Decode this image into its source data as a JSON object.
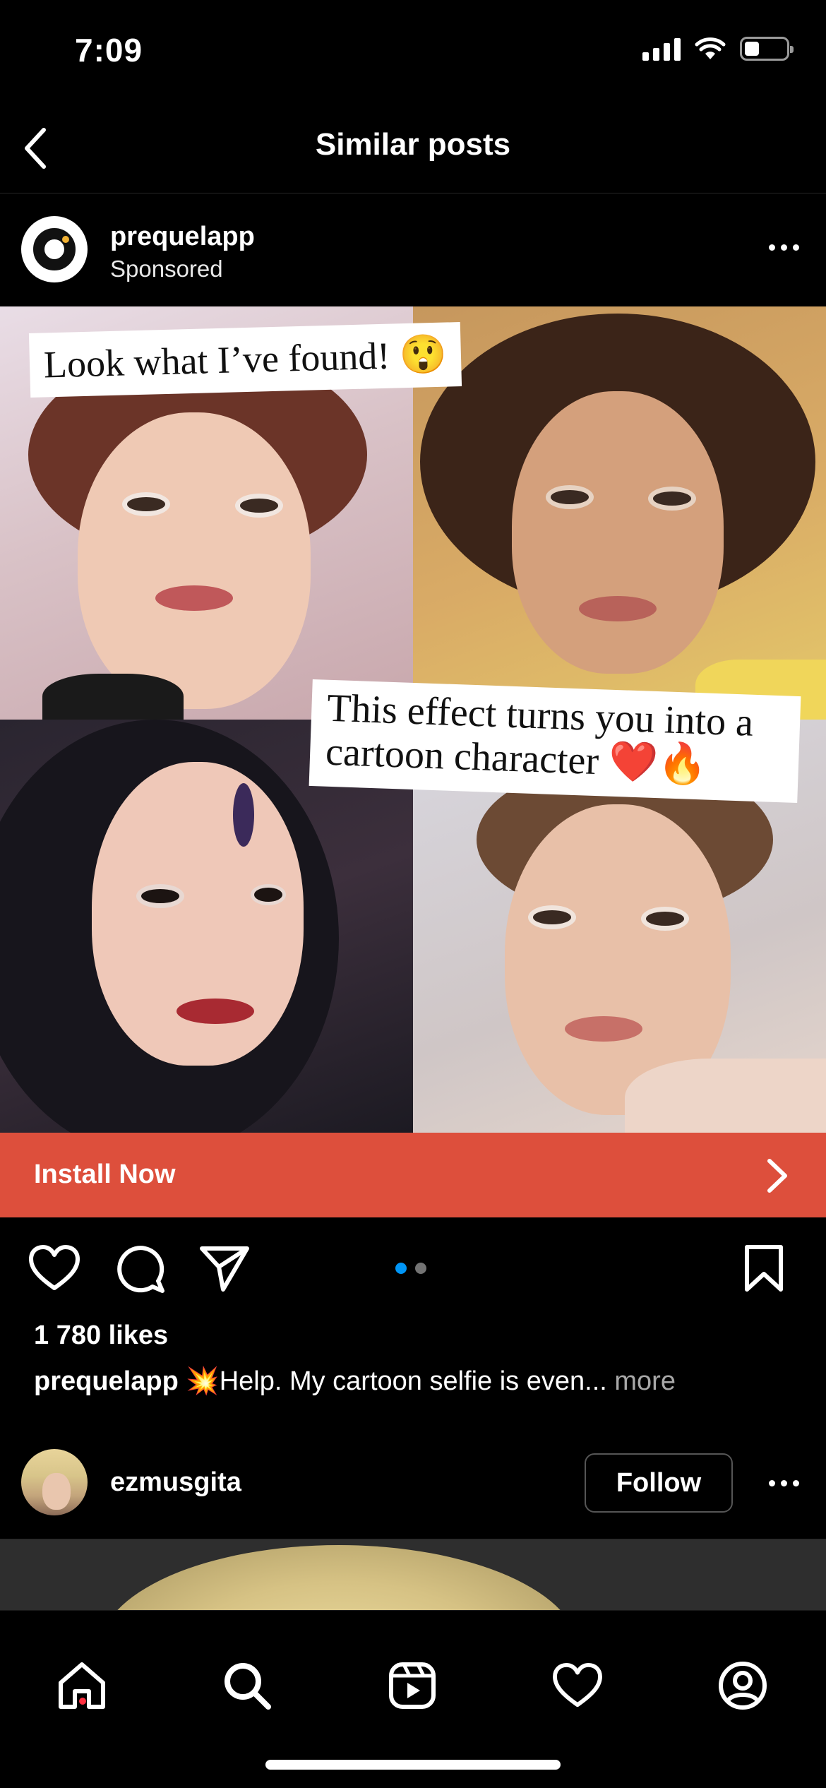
{
  "status_bar": {
    "time": "7:09"
  },
  "header": {
    "title": "Similar posts"
  },
  "post": {
    "username": "prequelapp",
    "subtitle": "Sponsored",
    "media": {
      "caption_top": "Look what I’ve found! 😲",
      "caption_bottom": "This effect turns you into a cartoon character ❤️🔥"
    },
    "cta": {
      "label": "Install Now"
    },
    "likes": "1 780 likes",
    "caption": {
      "user": "prequelapp",
      "text": "💥Help. My cartoon selfie is even...",
      "more": "more"
    },
    "carousel": {
      "total": 2,
      "active": 1
    },
    "colors": {
      "cta": "#dd4f3c",
      "carousel_active": "#0095f6",
      "carousel_inactive": "#737373"
    }
  },
  "next_post": {
    "username": "ezmusgita",
    "follow_label": "Follow"
  },
  "tab_bar": {
    "tabs": [
      "home-icon",
      "search-icon",
      "reels-icon",
      "heart-icon",
      "profile-icon"
    ],
    "active": "home-icon"
  }
}
